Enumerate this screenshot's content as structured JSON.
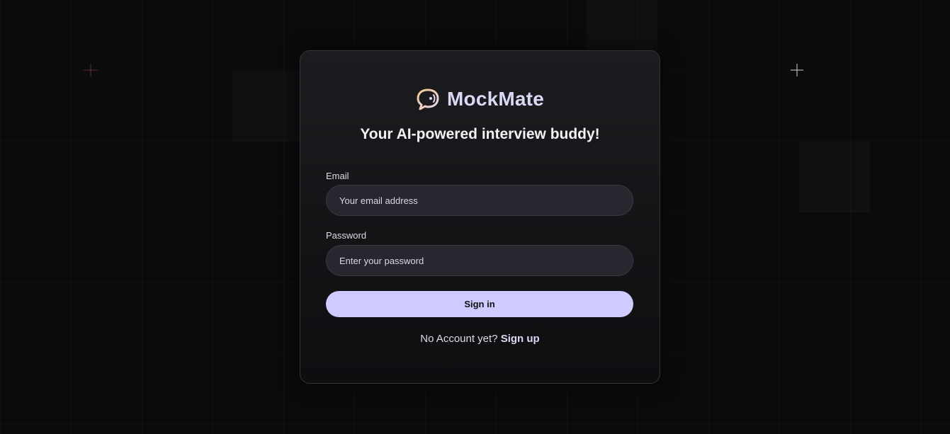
{
  "brand": {
    "name": "MockMate",
    "icon": "chat-bubble-icon",
    "accent": "#cfcbff"
  },
  "tagline": "Your AI-powered interview buddy!",
  "form": {
    "email_label": "Email",
    "email_placeholder": "Your email address",
    "password_label": "Password",
    "password_placeholder": "Enter your password",
    "submit_label": "Sign in"
  },
  "footer": {
    "prompt": "No Account yet?",
    "link_label": "Sign up"
  }
}
